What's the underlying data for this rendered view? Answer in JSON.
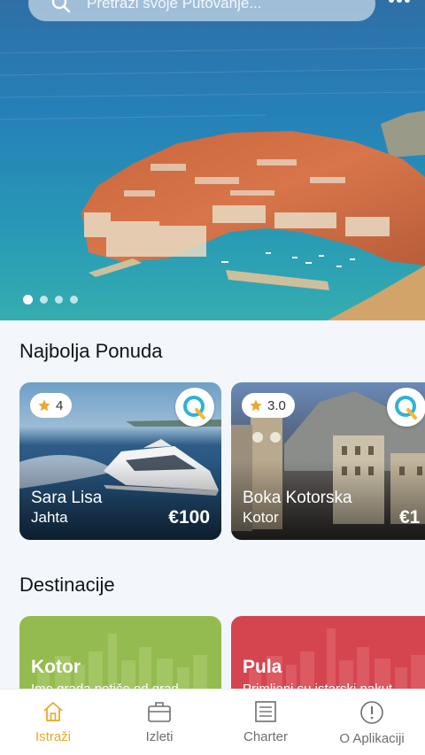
{
  "search": {
    "placeholder": "Pretraži svoje Putovanje..."
  },
  "carousel": {
    "slides": 4,
    "active_index": 0
  },
  "sections": {
    "offers_title": "Najbolja Ponuda",
    "destinations_title": "Destinacije"
  },
  "offers": [
    {
      "rating": "4",
      "name": "Sara Lisa",
      "subtitle": "Jahta",
      "price": "€100"
    },
    {
      "rating": "3.0",
      "name": "Boka Kotorska",
      "subtitle": "Kotor",
      "price": "€1"
    }
  ],
  "destinations": [
    {
      "name": "Kotor",
      "description": "Ime grada potiče od grad",
      "color": "#93bb4f"
    },
    {
      "name": "Pula",
      "description": "Primljeni su istarski nakut",
      "color": "#d4454f"
    }
  ],
  "nav": [
    {
      "label": "Istraži",
      "icon": "home-icon",
      "active": true
    },
    {
      "label": "Izleti",
      "icon": "briefcase-icon",
      "active": false
    },
    {
      "label": "Charter",
      "icon": "list-icon",
      "active": false
    },
    {
      "label": "O Aplikaciji",
      "icon": "info-icon",
      "active": false
    }
  ],
  "colors": {
    "accent": "#e9a92c",
    "nav_inactive": "#6e6e6e",
    "background": "#f3f6fb"
  }
}
